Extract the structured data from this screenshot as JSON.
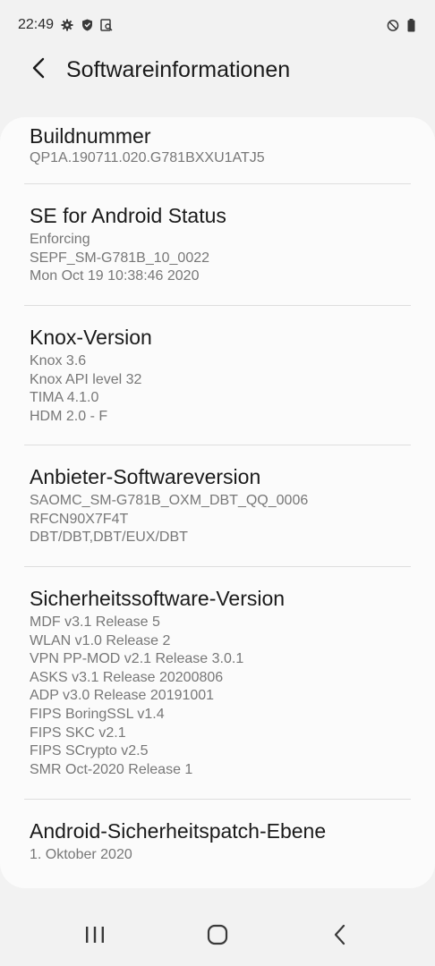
{
  "status_bar": {
    "time": "22:49",
    "left_icons": [
      "gear-icon",
      "shield-icon",
      "screenshot-search-icon"
    ],
    "right_icons": [
      "do-not-disturb-icon",
      "battery-icon"
    ]
  },
  "header": {
    "title": "Softwareinformationen",
    "back_icon": "back-arrow-icon"
  },
  "sections": [
    {
      "title": "Buildnummer",
      "lines": [
        "QP1A.190711.020.G781BXXU1ATJ5"
      ]
    },
    {
      "title": "SE for Android Status",
      "lines": [
        "Enforcing",
        "SEPF_SM-G781B_10_0022",
        "Mon Oct 19 10:38:46 2020"
      ]
    },
    {
      "title": "Knox-Version",
      "lines": [
        "Knox 3.6",
        "Knox API level 32",
        "TIMA 4.1.0",
        "HDM 2.0 - F"
      ]
    },
    {
      "title": "Anbieter-Softwareversion",
      "lines": [
        "SAOMC_SM-G781B_OXM_DBT_QQ_0006",
        "RFCN90X7F4T",
        "DBT/DBT,DBT/EUX/DBT"
      ]
    },
    {
      "title": "Sicherheitssoftware-Version",
      "lines": [
        "MDF v3.1 Release 5",
        "WLAN v1.0 Release 2",
        "VPN PP-MOD v2.1 Release 3.0.1",
        "ASKS v3.1 Release 20200806",
        "ADP v3.0 Release 20191001",
        "FIPS BoringSSL v1.4",
        "FIPS SKC v2.1",
        "FIPS SCrypto v2.5",
        "SMR Oct-2020 Release 1"
      ]
    },
    {
      "title": "Android-Sicherheitspatch-Ebene",
      "lines": [
        "1. Oktober 2020"
      ]
    }
  ],
  "nav_bar": {
    "buttons": [
      "recent-apps-icon",
      "home-icon",
      "back-icon"
    ]
  },
  "colors": {
    "background": "#f2f2f2",
    "card": "#fbfbfb",
    "title_text": "#1a1a1a",
    "secondary_text": "#777777",
    "divider": "#dedede"
  }
}
